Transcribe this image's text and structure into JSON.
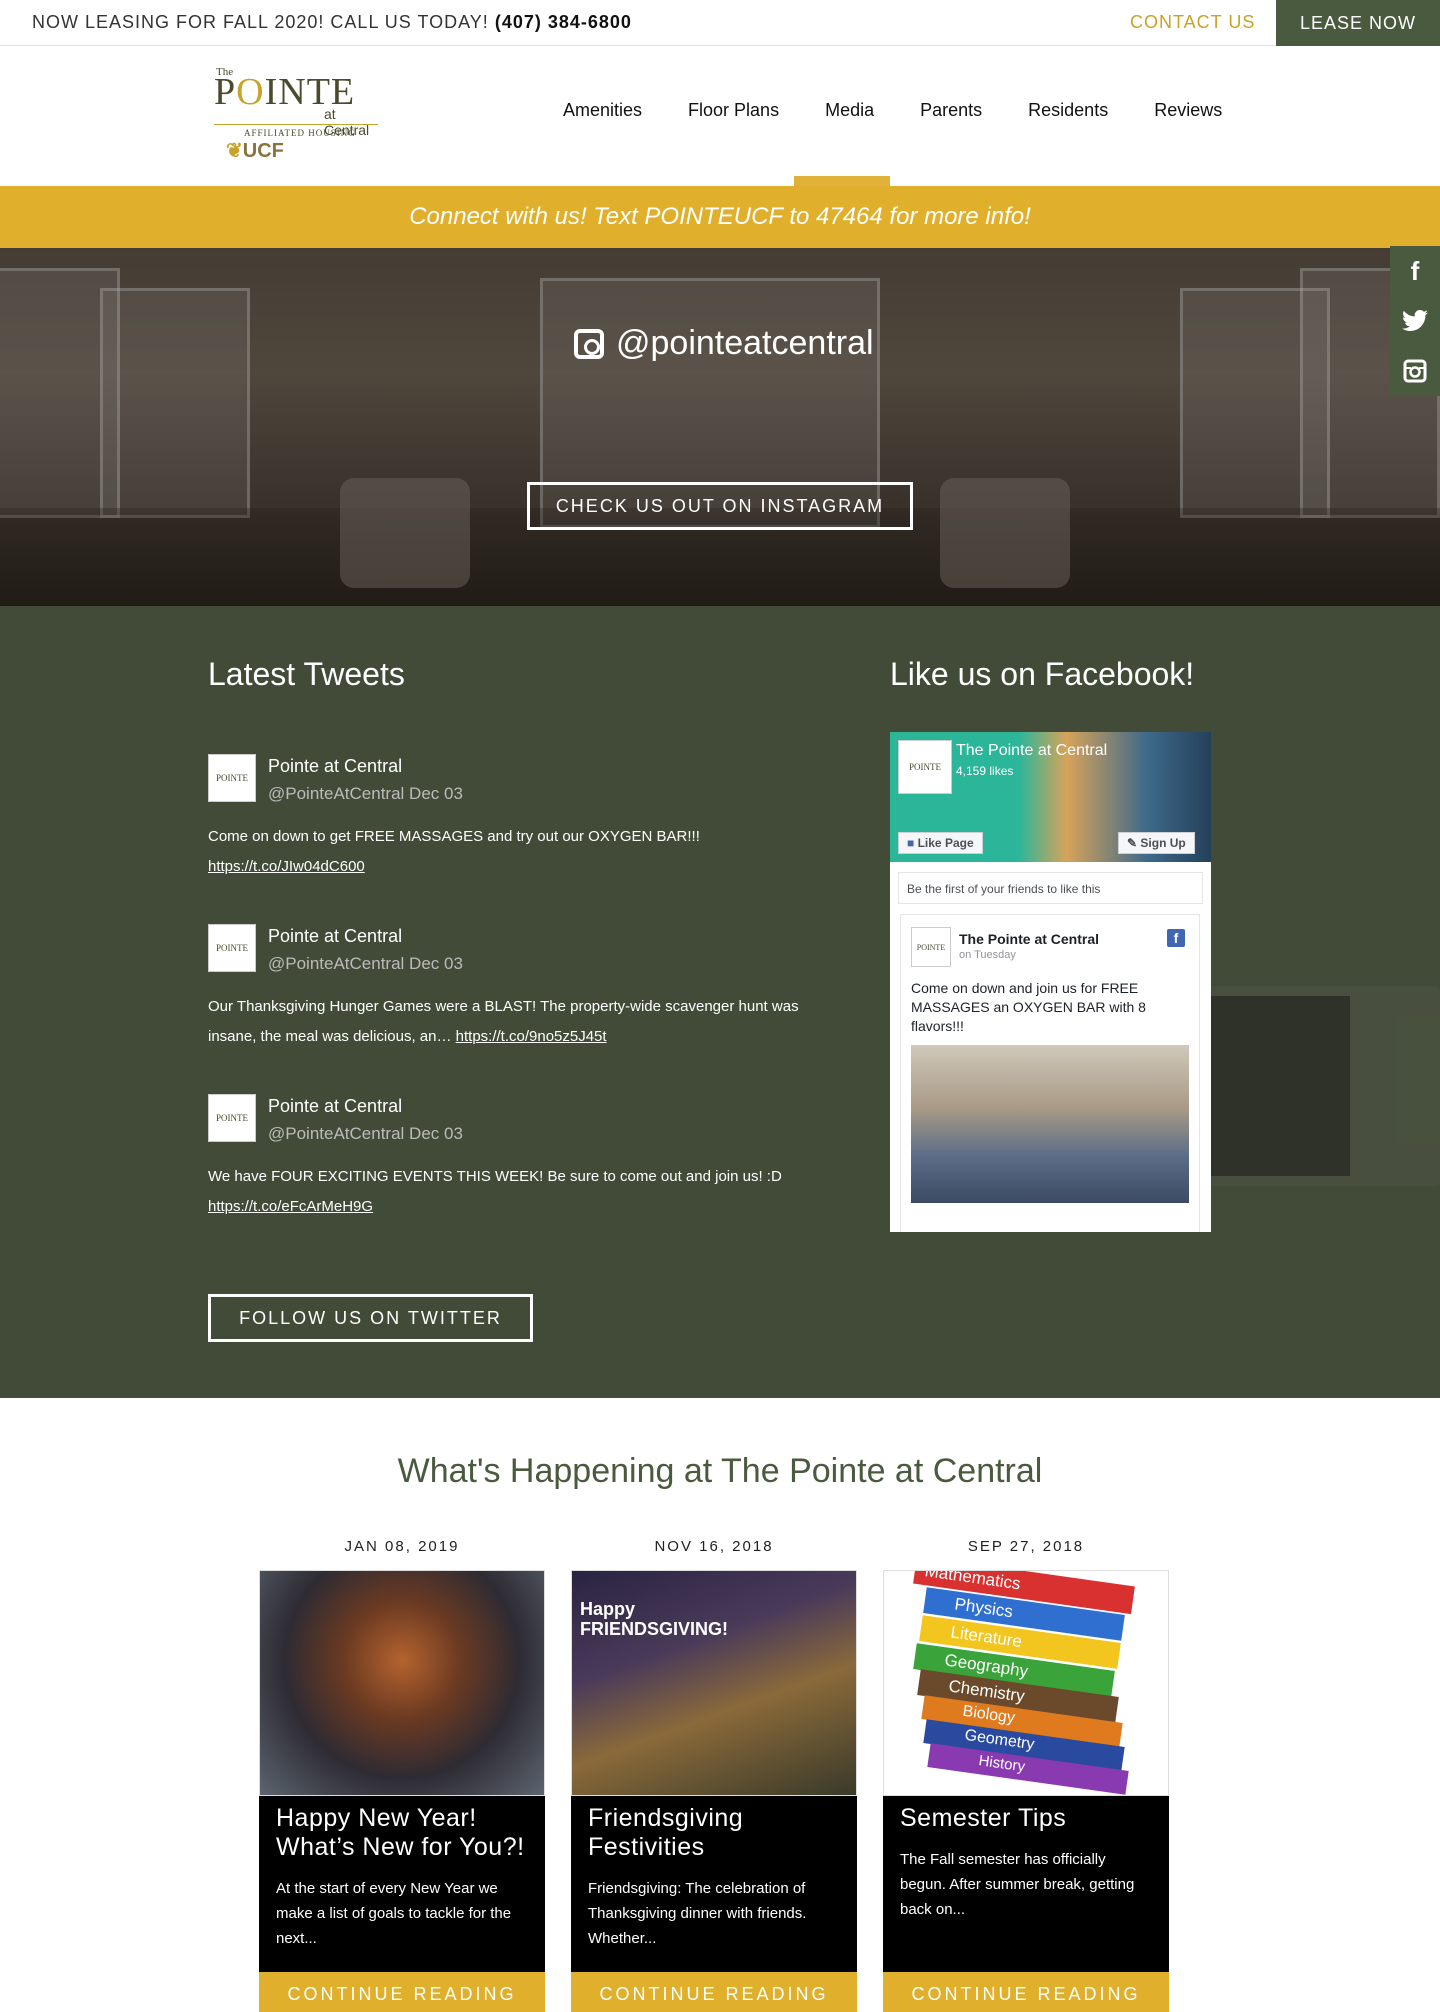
{
  "topbar": {
    "lease_text": "NOW LEASING FOR FALL 2020! CALL US TODAY!",
    "phone": "(407) 384-6800",
    "contact_label": "CONTACT US",
    "lease_now_label": "LEASE NOW"
  },
  "logo": {
    "the": "The",
    "pointe_p": "P",
    "pointe_o": "O",
    "pointe_rest": "INTE",
    "at_central": "at Central",
    "affiliated": "AFFILIATED HOUSING",
    "ucf": "UCF"
  },
  "nav": {
    "items": [
      "Amenities",
      "Floor Plans",
      "Media",
      "Parents",
      "Residents",
      "Reviews"
    ],
    "active": "Media"
  },
  "banner": {
    "text": "Connect with us! Text POINTEUCF to 47464 for more info!"
  },
  "hero": {
    "handle": "@pointeatcentral",
    "cta": "CHECK US OUT ON INSTAGRAM"
  },
  "social": {
    "facebook": "f",
    "twitter": "t",
    "instagram": "ig"
  },
  "tweets": {
    "title": "Latest Tweets",
    "items": [
      {
        "name": "Pointe at Central",
        "handle": "@PointeAtCentral Dec 03",
        "text": "Come on down to get FREE MASSAGES and try out our OXYGEN BAR!!!",
        "link": "https://t.co/JIw04dC600"
      },
      {
        "name": "Pointe at Central",
        "handle": "@PointeAtCentral Dec 03",
        "text": "Our Thanksgiving Hunger Games were a BLAST! The property-wide scavenger hunt was insane, the meal was delicious, an…",
        "link": "https://t.co/9no5z5J45t"
      },
      {
        "name": "Pointe at Central",
        "handle": "@PointeAtCentral Dec 03",
        "text": "We have FOUR EXCITING EVENTS THIS WEEK! Be sure to come out and join us! :D",
        "link": "https://t.co/eFcArMeH9G"
      }
    ],
    "follow_label": "FOLLOW US ON TWITTER",
    "avatar_text": "POINTE"
  },
  "facebook": {
    "title": "Like us on Facebook!",
    "page_name": "The Pointe at Central",
    "likes": "4,159 likes",
    "like_button": "Like Page",
    "signup_button": "Sign Up",
    "friends_text": "Be the first of your friends to like this",
    "post": {
      "name": "The Pointe at Central",
      "time": "on Tuesday",
      "text": "Come on down and join us for FREE MASSAGES an OXYGEN BAR with 8 flavors!!!"
    }
  },
  "happening": {
    "title": "What's Happening at The Pointe at Central",
    "posts": [
      {
        "date": "JAN 08, 2019",
        "title": "Happy New Year! What’s New for You?!",
        "excerpt": "At the start of every New Year we make a list of goals to tackle for the next...",
        "cta": "CONTINUE READING"
      },
      {
        "date": "NOV 16, 2018",
        "title": "Friendsgiving Festivities",
        "excerpt": "Friendsgiving: The celebration of Thanksgiving dinner with friends. Whether...",
        "cta": "CONTINUE READING"
      },
      {
        "date": "SEP 27, 2018",
        "title": "Semester Tips",
        "excerpt": "The Fall semester has officially begun. After summer break, getting back on...",
        "cta": "CONTINUE READING"
      }
    ],
    "img2_text": "Happy FRIENDSGIVING!",
    "img3_books": [
      "Mathematics",
      "Physics",
      "Literature",
      "Geography",
      "Chemistry",
      "Biology",
      "Geometry",
      "History"
    ]
  },
  "colors": {
    "accent_gold": "#e0b02d",
    "olive": "#4a5a3e",
    "contact_gold": "#c9a227"
  }
}
